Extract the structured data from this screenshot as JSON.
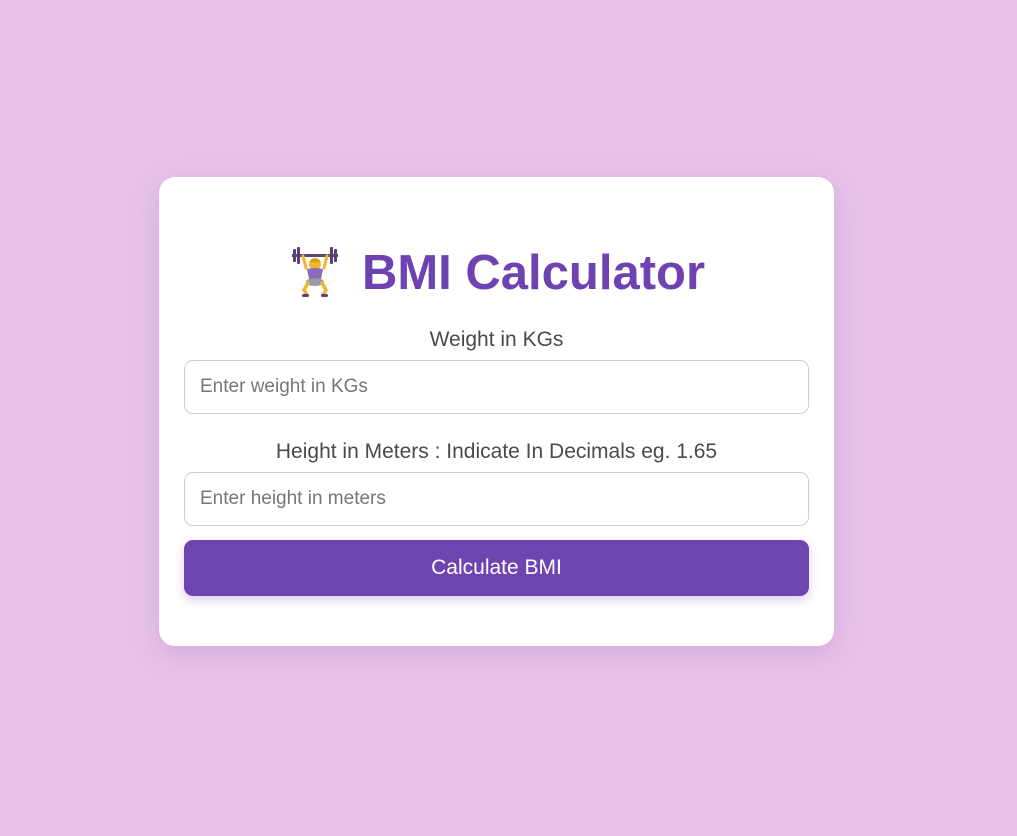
{
  "page": {
    "background_color": "#e7c3eb",
    "accent_color": "#6e44b1"
  },
  "card": {
    "title_icon": "weight-lifter-icon",
    "title": "BMI Calculator",
    "weight": {
      "label": "Weight in KGs",
      "value": "",
      "placeholder": "Enter weight in KGs"
    },
    "height": {
      "label": "Height in Meters : Indicate In Decimals eg. 1.65",
      "value": "",
      "placeholder": "Enter height in meters"
    },
    "button_label": "Calculate BMI"
  }
}
